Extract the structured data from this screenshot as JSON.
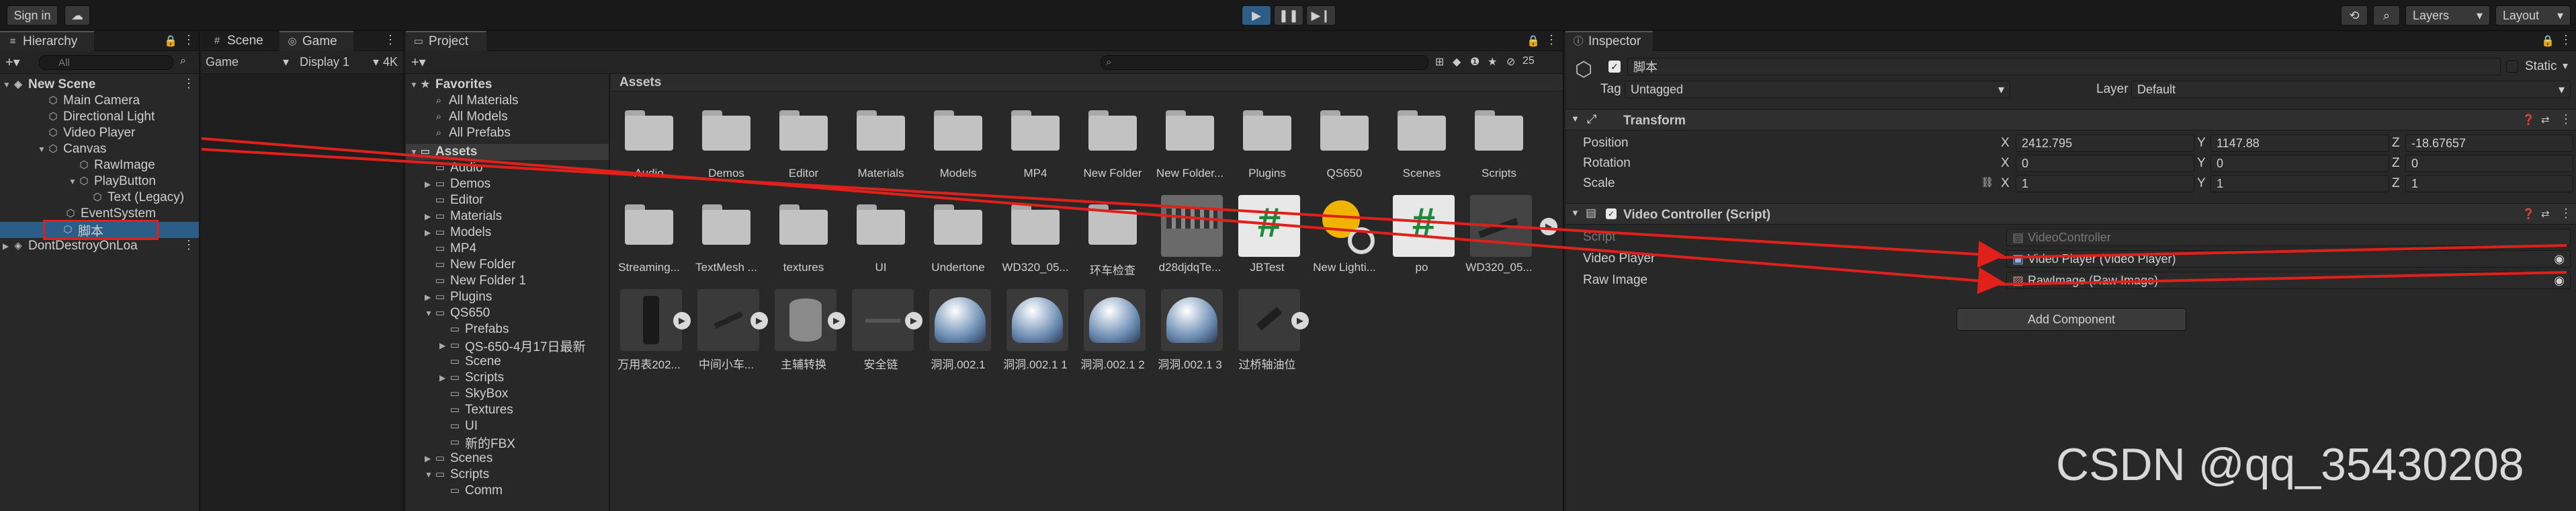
{
  "toolbar": {
    "sign_in": "Sign in",
    "layers": "Layers",
    "layout": "Layout"
  },
  "hierarchy": {
    "tab": "Hierarchy",
    "search_placeholder": "All",
    "items": [
      {
        "label": "New Scene"
      },
      {
        "label": "Main Camera"
      },
      {
        "label": "Directional Light"
      },
      {
        "label": "Video Player"
      },
      {
        "label": "Canvas"
      },
      {
        "label": "RawImage"
      },
      {
        "label": "PlayButton"
      },
      {
        "label": "Text (Legacy)"
      },
      {
        "label": "EventSystem"
      },
      {
        "label": "脚本"
      },
      {
        "label": "DontDestroyOnLoa"
      }
    ]
  },
  "game": {
    "tab_scene": "Scene",
    "tab_game": "Game",
    "mode": "Game",
    "display": "Display 1",
    "res": "4K"
  },
  "project": {
    "tab": "Project",
    "favorites": {
      "title": "Favorites",
      "items": [
        "All Materials",
        "All Models",
        "All Prefabs"
      ]
    },
    "tree": [
      {
        "label": "Assets"
      },
      {
        "label": "Audio"
      },
      {
        "label": "Demos"
      },
      {
        "label": "Editor"
      },
      {
        "label": "Materials"
      },
      {
        "label": "Models"
      },
      {
        "label": "MP4"
      },
      {
        "label": "New Folder"
      },
      {
        "label": "New Folder 1"
      },
      {
        "label": "Plugins"
      },
      {
        "label": "QS650"
      },
      {
        "label": "Prefabs"
      },
      {
        "label": "QS-650-4月17日最新"
      },
      {
        "label": "Scene"
      },
      {
        "label": "Scripts"
      },
      {
        "label": "SkyBox"
      },
      {
        "label": "Textures"
      },
      {
        "label": "UI"
      },
      {
        "label": "新的FBX"
      },
      {
        "label": "Scenes"
      },
      {
        "label": "Scripts"
      },
      {
        "label": "Comm"
      }
    ],
    "breadcrumb": "Assets",
    "count": "25",
    "row1": [
      "Audio",
      "Demos",
      "Editor",
      "Materials",
      "Models",
      "MP4",
      "New Folder",
      "New Folder...",
      "Plugins",
      "QS650",
      "Scenes",
      "Scripts"
    ],
    "row2": [
      "Streaming...",
      "TextMesh ...",
      "textures",
      "UI",
      "Undertone",
      "WD320_05...",
      "环车检查",
      "d28djdqTe...",
      "JBTest",
      "New Lighti...",
      "po",
      "WD320_05..."
    ],
    "row3": [
      "万用表202...",
      "中间小车...",
      "主辅转换",
      "安全链",
      "洞洞.002.1",
      "洞洞.002.1 1",
      "洞洞.002.1 2",
      "洞洞.002.1 3",
      "过桥轴油位"
    ]
  },
  "inspector": {
    "tab": "Inspector",
    "object_name": "脚本",
    "static": "Static",
    "tag_label": "Tag",
    "tag_value": "Untagged",
    "layer_label": "Layer",
    "layer_value": "Default",
    "transform": {
      "title": "Transform",
      "position": {
        "label": "Position",
        "x": "2412.795",
        "y": "1147.88",
        "z": "-18.67657"
      },
      "rotation": {
        "label": "Rotation",
        "x": "0",
        "y": "0",
        "z": "0"
      },
      "scale": {
        "label": "Scale",
        "x": "1",
        "y": "1",
        "z": "1"
      }
    },
    "video_controller": {
      "title": "Video Controller (Script)",
      "script_label": "Script",
      "script_value": "VideoController",
      "video_player_label": "Video Player",
      "video_player_value": "Video Player (Video Player)",
      "raw_image_label": "Raw Image",
      "raw_image_value": "RawImage (Raw Image)"
    },
    "add_component": "Add Component"
  },
  "watermark": "CSDN @qq_35430208",
  "colors": {
    "accent": "#2c5d87",
    "annotation": "#e0201a",
    "selection": "#2c5d87"
  }
}
